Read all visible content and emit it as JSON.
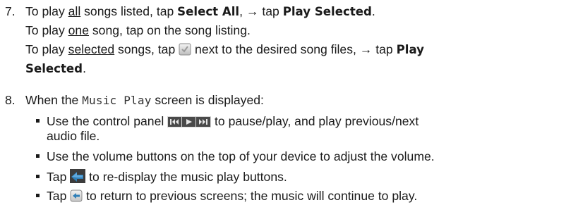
{
  "step7": {
    "number": "7.",
    "line1": {
      "pre": "To play ",
      "u": "all",
      "mid": " songs listed, tap ",
      "b1": "Select All",
      "arrow": ", → tap ",
      "b2": "Play Selected",
      "end": "."
    },
    "line2": {
      "pre": "To play ",
      "u": "one",
      "post": " song, tap on the song listing."
    },
    "line3": {
      "pre": "To play ",
      "u": "selected",
      "mid": " songs, tap ",
      "after_icon": " next to the desired song files, → tap ",
      "b1": "Play"
    },
    "line4": {
      "b1": "Selected",
      "end": "."
    },
    "checkbox_icon": "checkbox-icon"
  },
  "step8": {
    "number": "8.",
    "intro": {
      "pre": "When the ",
      "mono": "Music Play",
      "post": " screen is displayed:"
    },
    "bullets": [
      {
        "pre": "Use the control panel ",
        "icon": "media-controls-icon",
        "post": " to pause/play, and play previous/next",
        "cont": "audio file."
      },
      {
        "text": "Use the volume buttons on the top of your device to adjust the volume."
      },
      {
        "pre": "Tap ",
        "icon": "back-arrow-icon",
        "post": " to re-display the music play buttons."
      },
      {
        "pre": "Tap ",
        "icon": "return-icon",
        "post": " to return to previous screens; the music will continue to play."
      }
    ]
  },
  "colors": {
    "text": "#1a1a1a",
    "icon_dark": "#3a3a3a",
    "icon_blue": "#2f7fb8",
    "icon_gray": "#c8c8c8"
  }
}
